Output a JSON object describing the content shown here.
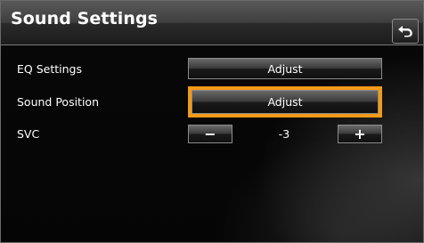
{
  "header": {
    "title": "Sound Settings",
    "back_icon": "return-arrow-icon"
  },
  "settings": {
    "eq": {
      "label": "EQ Settings",
      "button": "Adjust"
    },
    "sound_position": {
      "label": "Sound Position",
      "button": "Adjust"
    },
    "svc": {
      "label": "SVC",
      "decrement": "−",
      "value": "-3",
      "increment": "+"
    }
  },
  "colors": {
    "focus_highlight": "#f29a18",
    "background": "#050505",
    "text": "#ffffff"
  }
}
